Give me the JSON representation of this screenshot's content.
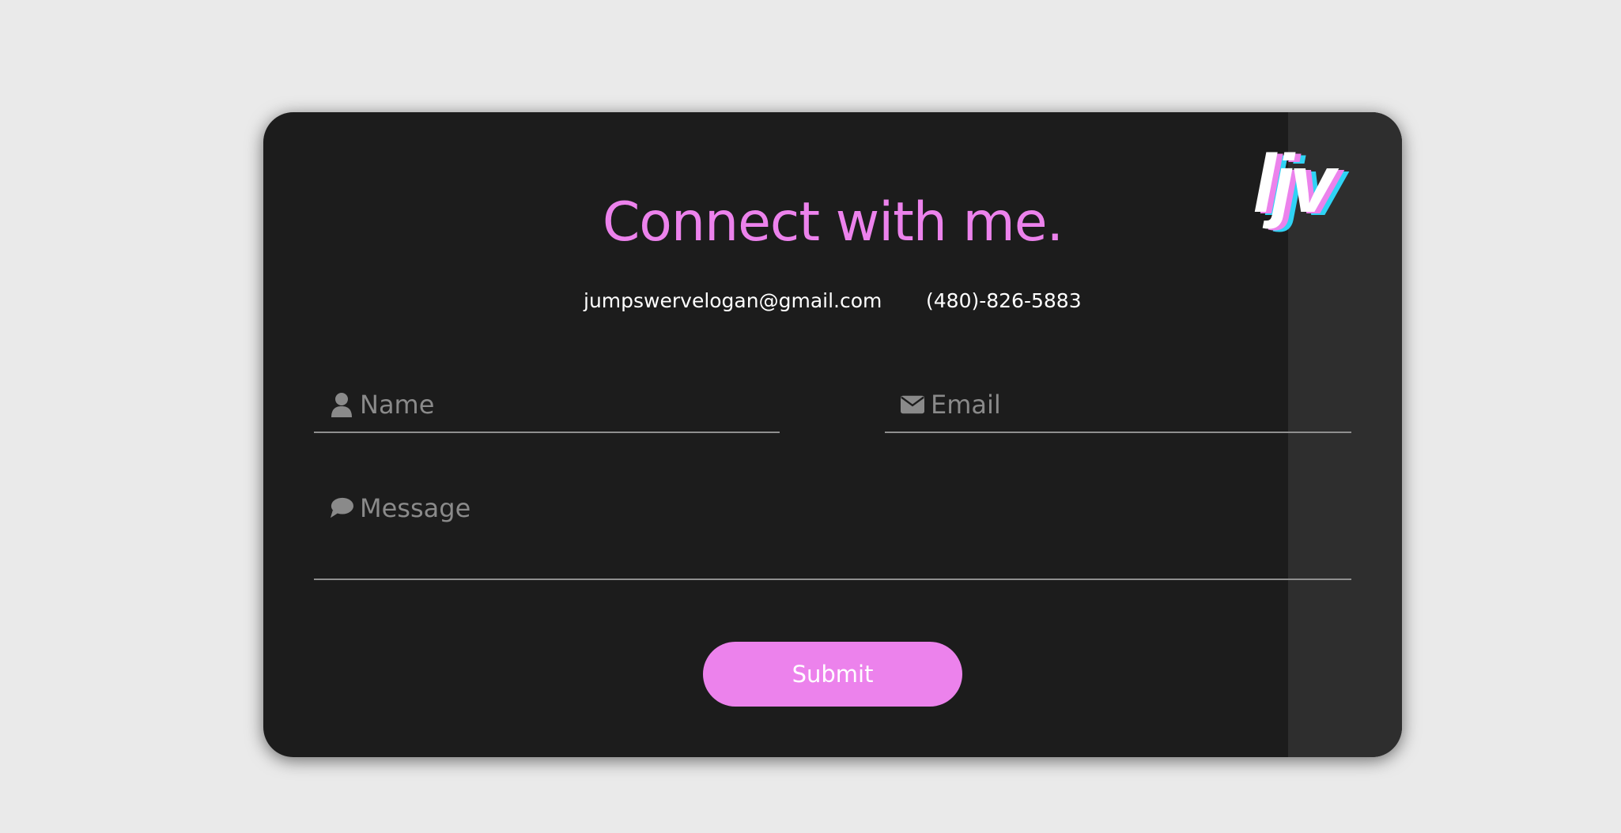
{
  "logo": {
    "text": "ljv"
  },
  "header": {
    "title": "Connect with me."
  },
  "contact": {
    "email": "jumpswervelogan@gmail.com",
    "phone": "(480)-826-5883"
  },
  "form": {
    "name": {
      "placeholder": "Name",
      "value": "",
      "icon": "user-icon"
    },
    "email": {
      "placeholder": "Email",
      "value": "",
      "icon": "envelope-icon"
    },
    "message": {
      "placeholder": "Message",
      "value": "",
      "icon": "speech-bubble-icon"
    },
    "submit_label": "Submit"
  },
  "colors": {
    "accent": "#ec82ec",
    "card_bg": "#1c1c1c",
    "page_bg": "#eaeaea",
    "side_strip": "#2e2e2e",
    "logo_shadow_cyan": "#2fd3f5",
    "placeholder": "#8a8a8a"
  }
}
